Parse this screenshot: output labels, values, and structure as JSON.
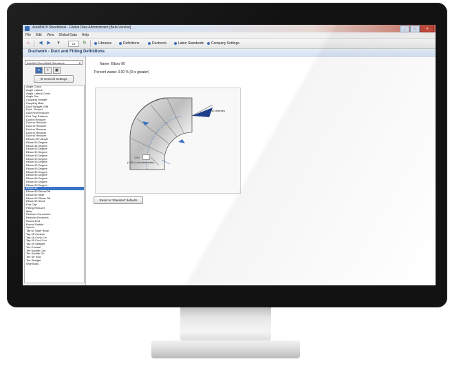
{
  "window": {
    "title": "AutoBid ® SheetMetal - Global Data Administrator [Beta Version]",
    "buttons": [
      "_",
      "□",
      "✕"
    ]
  },
  "menubar": [
    "File",
    "Edit",
    "View",
    "Global Data",
    "Help"
  ],
  "toolbar": {
    "combo_value": "15",
    "items": [
      "Libraries",
      "Definitions",
      "Ductwork",
      "Labor Standards",
      "Company Settings"
    ]
  },
  "header": {
    "title": "Ductwork - Duct and Fitting Definitions"
  },
  "sidebar": {
    "select_value": "AutoBid SheetMetal Standards",
    "general_settings_label": "General Settings",
    "selected_index": 31,
    "items": [
      "Angle Cross",
      "Angle Lateral",
      "Angle Lateral Cross",
      "Angle Tee",
      "Coupling Female",
      "Coupling Male",
      "Duct Straight (Off)",
      "Duct - Round",
      "Duct Rnd Reducer",
      "End Cap Reducer",
      "Duct in Reducer",
      "Duct w/ Reducer",
      "Duct w/ Reducer",
      "Duct w/ Reducer",
      "Duct w/ Reducer",
      "Duct w/ Reducer",
      "Elbow (45°) Angle",
      "Elbow 90 Degree",
      "Elbow 45 Degree",
      "Elbow 90 Degree",
      "Elbow 90 Degree",
      "Elbow 90 Degree",
      "Elbow 90 Degree",
      "Elbow 90 Degree",
      "Elbow 90 Degree",
      "Elbow 90 Degree",
      "Elbow 90 Degree",
      "Elbow 90 Degree",
      "Elbow 90 Degree",
      "Elbow 90 Degree",
      "Elbow 90 Degree",
      "Elbow 90",
      "Elbow 90 Elbow/Off",
      "Elbow 90 Slide",
      "Elbow 90 Elbow Off",
      "Elbow 90 Short",
      "End Cap",
      "Fitting Reducer",
      "Miter",
      "Reducer Concentric",
      "Reducer Eccentric",
      "Round End",
      "Round Saddle",
      "Spin In",
      "Tap w/ Taper Body",
      "Tap 45 Conical",
      "Tap 45 Conic On",
      "Tap 45 Conl Con",
      "Tap 45 Straight",
      "Tee Conical",
      "Tee Saddle Con",
      "Tee Saddle On",
      "Tee Str Red",
      "Tee Straight",
      "Wye Body"
    ]
  },
  "main": {
    "name_label": "Name:",
    "name_value": "Elbow 90",
    "percent_waste_label": "Percent waste:",
    "percent_waste_value": "0.00 %  (0 is greater)",
    "angle_label": "90 degrees",
    "radius_value": "1.50",
    "radius_label": "(1.50 x duct diameter)",
    "reset_button_label": "Reset to 'Standard' defaults"
  },
  "colors": {
    "accent": "#3a74c8",
    "header_text": "#1f3a62",
    "bezel": "#121212"
  }
}
